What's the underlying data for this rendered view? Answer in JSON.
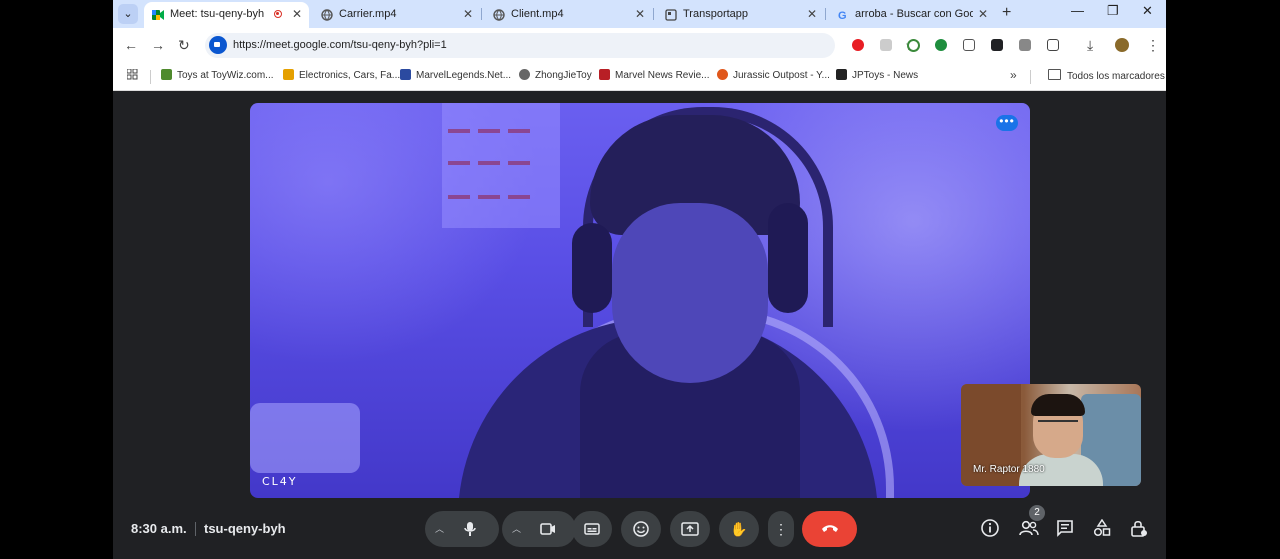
{
  "tabs": [
    {
      "title": "Meet: tsu-qeny-byh",
      "active": true,
      "recording": true
    },
    {
      "title": "Carrier.mp4",
      "active": false
    },
    {
      "title": "Client.mp4",
      "active": false
    },
    {
      "title": "Transportapp",
      "active": false
    },
    {
      "title": "arroba - Buscar con Google",
      "active": false
    }
  ],
  "omnibox": {
    "url": "https://meet.google.com/tsu-qeny-byh?pli=1"
  },
  "bookmarks": {
    "items": [
      {
        "label": "Toys at ToyWiz.com...",
        "color": "#4f8a2d"
      },
      {
        "label": "Electronics, Cars, Fa...",
        "color": "#e5a000"
      },
      {
        "label": "MarvelLegends.Net...",
        "color": "#2b4aa0"
      },
      {
        "label": "ZhongJieToy",
        "color": "#666666"
      },
      {
        "label": "Marvel News Revie...",
        "color": "#b81f25"
      },
      {
        "label": "Jurassic Outpost - Y...",
        "color": "#e0571b"
      },
      {
        "label": "JPToys - News",
        "color": "#222222"
      }
    ],
    "all_label": "Todos los marcadores"
  },
  "meet": {
    "main_participant": "CL4Y",
    "self_participant": "Mr. Raptor 1880",
    "clock": "8:30 a.m.",
    "meeting_code": "tsu-qeny-byh",
    "people_count": "2",
    "end_call_color": "#ea4335"
  },
  "icons": {
    "tab_search": "chevron-down-icon",
    "mic": "microphone-icon",
    "camera": "video-camera-icon",
    "captions": "closed-captions-icon",
    "emoji": "emoji-icon",
    "present": "present-screen-icon",
    "hand": "raise-hand-icon",
    "more": "more-options-icon",
    "end": "end-call-icon"
  }
}
